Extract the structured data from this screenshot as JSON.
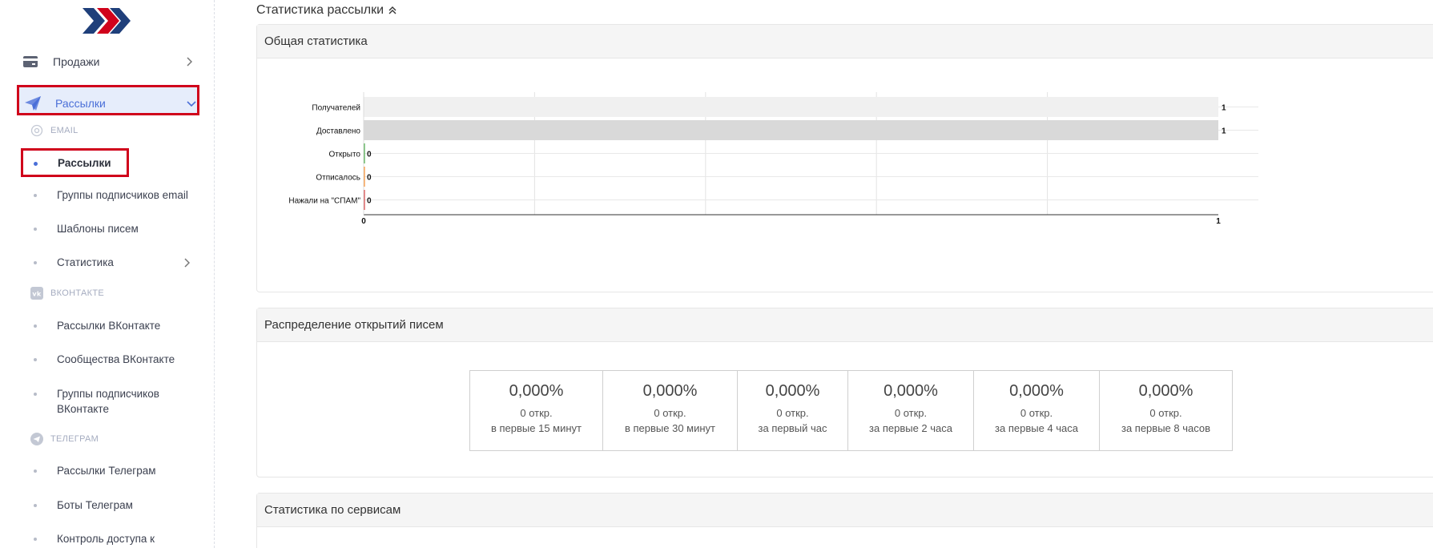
{
  "sidebar": {
    "top_items": [
      {
        "label": "Продажи",
        "icon": "card-icon"
      },
      {
        "label": "Рассылки",
        "icon": "paper-plane-icon"
      }
    ],
    "sections": {
      "email": {
        "label": "EMAIL",
        "icon": "at-icon"
      },
      "vk": {
        "label": "ВКОНТАКТЕ",
        "icon": "vk-icon"
      },
      "telegram": {
        "label": "ТЕЛЕГРАМ",
        "icon": "telegram-icon"
      }
    },
    "email_items": [
      "Рассылки",
      "Группы подписчиков email",
      "Шаблоны писем",
      "Статистика"
    ],
    "vk_items": [
      "Рассылки ВКонтакте",
      "Сообщества ВКонтакте",
      "Группы подписчиков ВКонтакте"
    ],
    "telegram_items": [
      "Рассылки Телеграм",
      "Боты Телеграм",
      "Контроль доступа к"
    ]
  },
  "main": {
    "title": "Статистика рассылки",
    "panels": {
      "general": "Общая статистика",
      "opens": "Распределение открытий писем",
      "services": "Статистика по сервисам"
    },
    "opens_table": [
      {
        "pct": "0,000%",
        "count": "0 откр.",
        "desc": "в первые 15 минут"
      },
      {
        "pct": "0,000%",
        "count": "0 откр.",
        "desc": "в первые 30 минут"
      },
      {
        "pct": "0,000%",
        "count": "0 откр.",
        "desc": "за первый час"
      },
      {
        "pct": "0,000%",
        "count": "0 откр.",
        "desc": "за первые 2 часа"
      },
      {
        "pct": "0,000%",
        "count": "0 откр.",
        "desc": "за первые 4 часа"
      },
      {
        "pct": "0,000%",
        "count": "0 откр.",
        "desc": "за первые 8 часов"
      }
    ]
  },
  "colors": {
    "accent": "#4a6fd8",
    "highlight_border": "#d0021b",
    "bar_recipients": "#f0f0f0",
    "bar_delivered": "#d9d9d9"
  },
  "chart_data": {
    "type": "bar",
    "orientation": "horizontal",
    "categories": [
      "Получателей",
      "Доставлено",
      "Открыто",
      "Отписалось",
      "Нажали на \"СПАМ\""
    ],
    "values": [
      1,
      1,
      0,
      0,
      0
    ],
    "value_labels": [
      "1",
      "1",
      "0",
      "0",
      "0"
    ],
    "bar_colors": [
      "#f0f0f0",
      "#d9d9d9",
      "#2ca02c",
      "#ff7f0e",
      "#d62728"
    ],
    "xlim": [
      0,
      1
    ],
    "x_ticks": [
      "0",
      "1"
    ],
    "grid": true
  }
}
